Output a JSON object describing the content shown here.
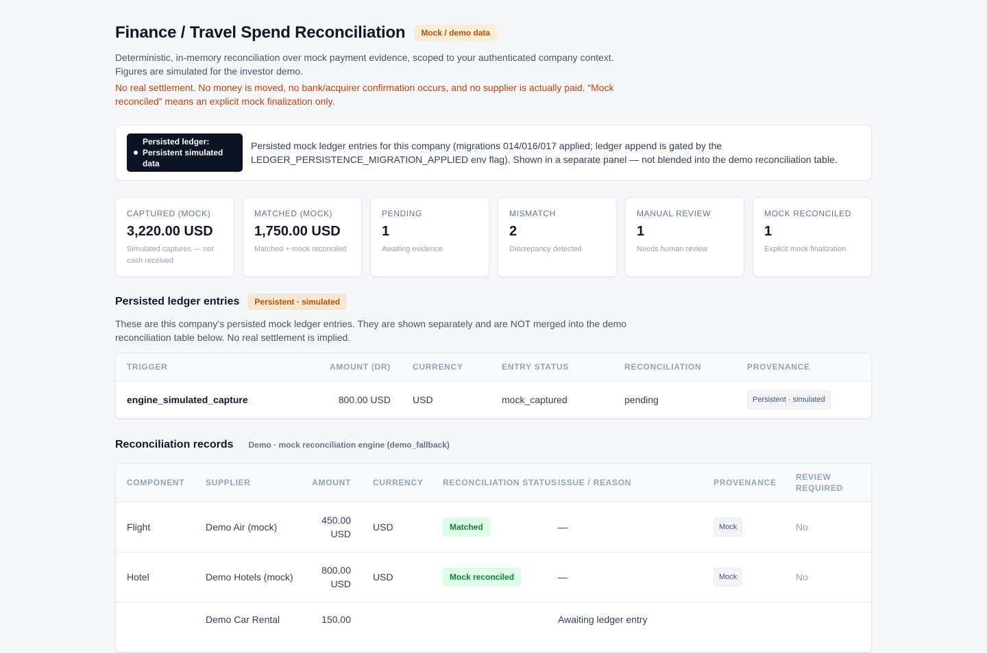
{
  "header": {
    "title": "Finance / Travel Spend Reconciliation",
    "badge": "Mock / demo data",
    "subtitle": "Deterministic, in-memory reconciliation over mock payment evidence, scoped to your authenticated company context. Figures are simulated for the investor demo.",
    "warning": "No real settlement. No money is moved, no bank/acquirer confirmation occurs, and no supplier is actually paid. “Mock reconciled” means an explicit mock finalization only."
  },
  "ledger_banner": {
    "badge_line1": "Persisted ledger:",
    "badge_line2": "Persistent simulated data",
    "text": "Persisted mock ledger entries for this company (migrations 014/016/017 applied; ledger append is gated by the LEDGER_PERSISTENCE_MIGRATION_APPLIED env flag). Shown in a separate panel — not blended into the demo reconciliation table."
  },
  "kpis": [
    {
      "label": "Captured (mock)",
      "value": "3,220.00 USD",
      "note": "Simulated captures — not cash received"
    },
    {
      "label": "Matched (mock)",
      "value": "1,750.00 USD",
      "note": "Matched + mock reconciled"
    },
    {
      "label": "Pending",
      "value": "1",
      "note": "Awaiting evidence"
    },
    {
      "label": "Mismatch",
      "value": "2",
      "note": "Discrepancy detected"
    },
    {
      "label": "Manual review",
      "value": "1",
      "note": "Needs human review"
    },
    {
      "label": "Mock reconciled",
      "value": "1",
      "note": "Explicit mock finalization"
    }
  ],
  "ledger_section": {
    "title": "Persisted ledger entries",
    "badge": "Persistent · simulated",
    "description": "These are this company's persisted mock ledger entries. They are shown separately and are NOT merged into the demo reconciliation table below. No real settlement is implied.",
    "columns": [
      "Trigger",
      "Amount (DR)",
      "Currency",
      "Entry status",
      "Reconciliation",
      "Provenance"
    ],
    "rows": [
      {
        "trigger": "engine_simulated_capture",
        "amount": "800.00 USD",
        "currency": "USD",
        "entry_status": "mock_captured",
        "reconciliation": "pending",
        "provenance": "Persistent · simulated"
      }
    ]
  },
  "records_section": {
    "title": "Reconciliation records",
    "tag": "Demo · mock reconciliation engine (demo_fallback)",
    "columns": [
      "Component",
      "Supplier",
      "Amount",
      "Currency",
      "Reconciliation status",
      "Issue / reason",
      "Provenance",
      "Review required"
    ],
    "rows": [
      {
        "component": "Flight",
        "supplier": "Demo Air (mock)",
        "amount": "450.00 USD",
        "currency": "USD",
        "status": "Matched",
        "issue": "—",
        "provenance": "Mock",
        "review": "No"
      },
      {
        "component": "Hotel",
        "supplier": "Demo Hotels (mock)",
        "amount": "800.00 USD",
        "currency": "USD",
        "status": "Mock reconciled",
        "issue": "—",
        "provenance": "Mock",
        "review": "No"
      },
      {
        "component": "",
        "supplier": "Demo Car Rental",
        "amount": "150.00",
        "currency": "",
        "status": "",
        "issue": "Awaiting ledger entry",
        "provenance": "",
        "review": ""
      }
    ]
  }
}
